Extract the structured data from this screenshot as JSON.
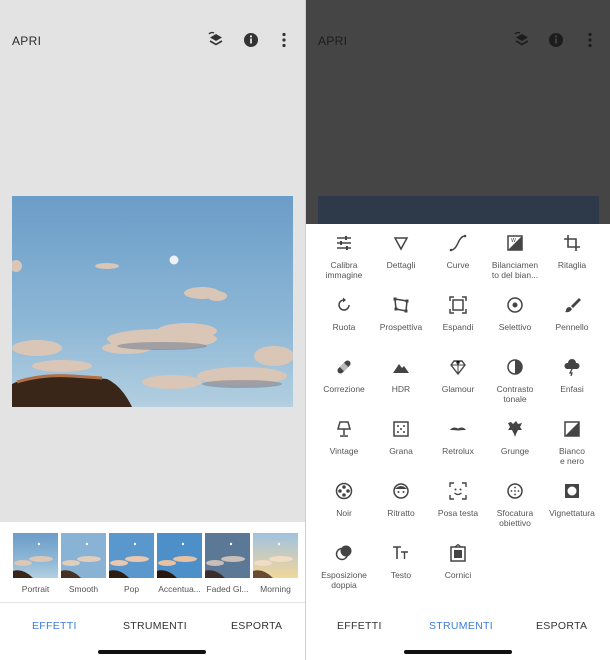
{
  "left_screen": {
    "header": {
      "open_label": "APRI"
    },
    "looks": [
      {
        "label": "Portrait"
      },
      {
        "label": "Smooth"
      },
      {
        "label": "Pop"
      },
      {
        "label": "Accentua..."
      },
      {
        "label": "Faded Gl..."
      },
      {
        "label": "Morning"
      }
    ],
    "tabs": {
      "effects": "EFFETTI",
      "tools": "STRUMENTI",
      "export": "ESPORTA"
    },
    "active_tab": "effects"
  },
  "right_screen": {
    "header": {
      "open_label": "APRI"
    },
    "tools": [
      {
        "label": "Calibra\nimmagine",
        "icon": "tune-sliders-icon"
      },
      {
        "label": "Dettagli",
        "icon": "triangle-down-icon"
      },
      {
        "label": "Curve",
        "icon": "curve-icon"
      },
      {
        "label": "Bilanciamen\nto del bian...",
        "icon": "white-balance-icon"
      },
      {
        "label": "Ritaglia",
        "icon": "crop-icon"
      },
      {
        "label": "Ruota",
        "icon": "rotate-icon"
      },
      {
        "label": "Prospettiva",
        "icon": "perspective-icon"
      },
      {
        "label": "Espandi",
        "icon": "expand-icon"
      },
      {
        "label": "Selettivo",
        "icon": "target-icon"
      },
      {
        "label": "Pennello",
        "icon": "brush-icon"
      },
      {
        "label": "Correzione",
        "icon": "bandage-icon"
      },
      {
        "label": "HDR",
        "icon": "mountains-icon"
      },
      {
        "label": "Glamour",
        "icon": "diamond-icon"
      },
      {
        "label": "Contrasto\ntonale",
        "icon": "contrast-icon"
      },
      {
        "label": "Enfasi",
        "icon": "cloud-bolt-icon"
      },
      {
        "label": "Vintage",
        "icon": "lamp-icon"
      },
      {
        "label": "Grana",
        "icon": "grain-icon"
      },
      {
        "label": "Retrolux",
        "icon": "mustache-icon"
      },
      {
        "label": "Grunge",
        "icon": "grunge-icon"
      },
      {
        "label": "Bianco\ne nero",
        "icon": "black-white-icon"
      },
      {
        "label": "Noir",
        "icon": "film-reel-icon"
      },
      {
        "label": "Ritratto",
        "icon": "face-icon"
      },
      {
        "label": "Posa testa",
        "icon": "face-frame-icon"
      },
      {
        "label": "Sfocatura\nobiettivo",
        "icon": "lens-blur-icon"
      },
      {
        "label": "Vignettatura",
        "icon": "vignette-icon"
      },
      {
        "label": "Esposizione\ndoppia",
        "icon": "double-exposure-icon"
      },
      {
        "label": "Testo",
        "icon": "text-icon"
      },
      {
        "label": "Cornici",
        "icon": "frame-icon"
      }
    ],
    "tabs": {
      "effects": "EFFETTI",
      "tools": "STRUMENTI",
      "export": "ESPORTA"
    },
    "active_tab": "tools"
  },
  "colors": {
    "accent": "#3b7de0",
    "tab_inactive": "#333333",
    "icon_dark": "#444444"
  }
}
